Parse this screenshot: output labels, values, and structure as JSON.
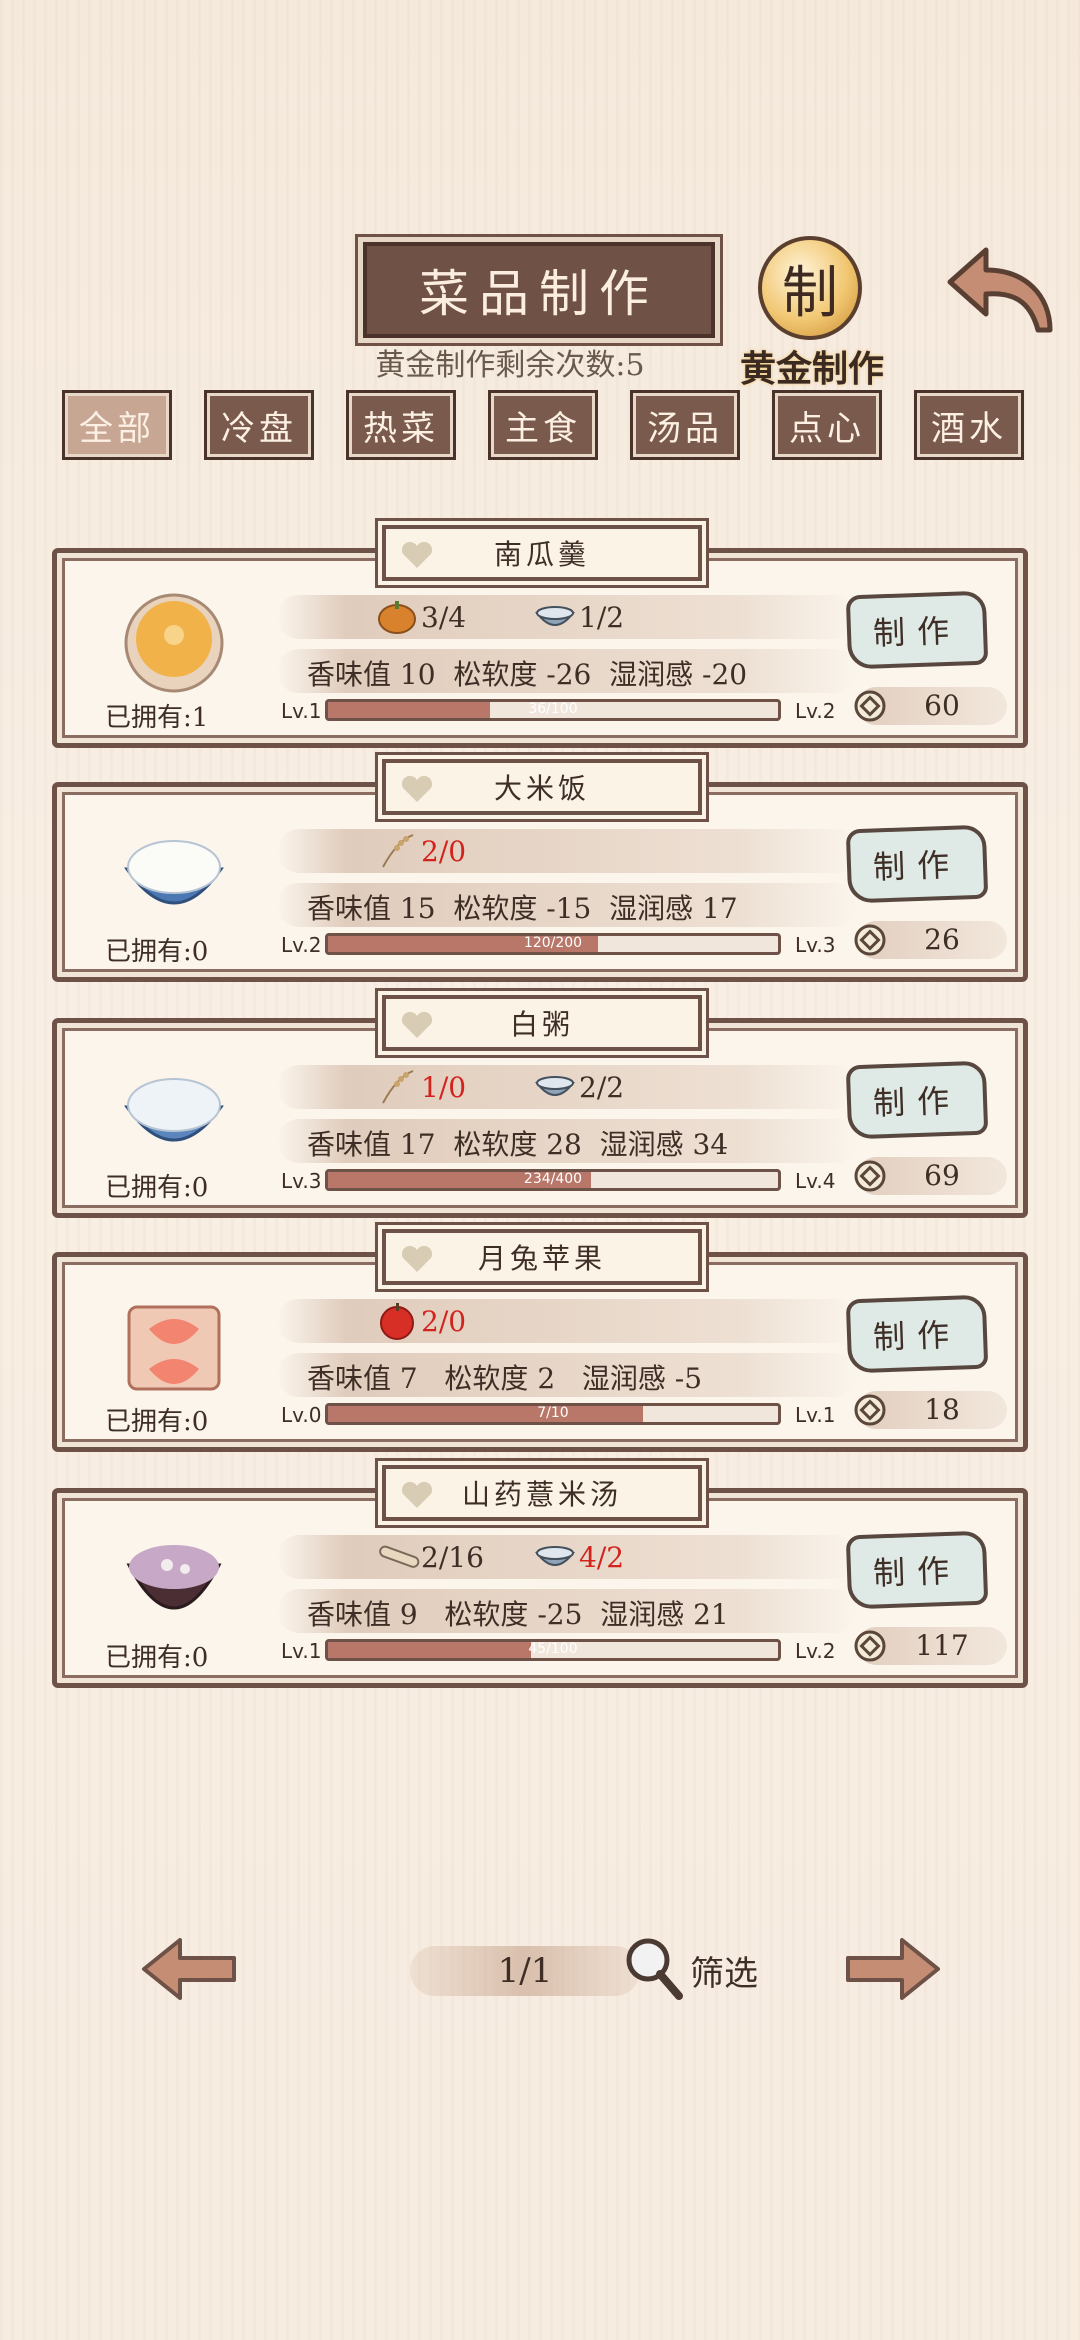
{
  "header": {
    "title": "菜品制作",
    "gold_remaining": "黄金制作剩余次数:5",
    "gold_seal_char": "制",
    "gold_button_label": "黄金制作"
  },
  "tabs": [
    {
      "label": "全部",
      "active": true
    },
    {
      "label": "冷盘",
      "active": false
    },
    {
      "label": "热菜",
      "active": false
    },
    {
      "label": "主食",
      "active": false
    },
    {
      "label": "汤品",
      "active": false
    },
    {
      "label": "点心",
      "active": false
    },
    {
      "label": "酒水",
      "active": false
    }
  ],
  "make_label": "制作",
  "recipes": [
    {
      "name": "南瓜羹",
      "owned": "已拥有:1",
      "ingredients": [
        {
          "icon": "pumpkin-icon",
          "count": "3/4",
          "short": false
        },
        {
          "icon": "bowl-icon",
          "count": "1/2",
          "short": false
        }
      ],
      "stats": "香味值 10  松软度 -26  湿润感 -20",
      "level": "Lv.1",
      "next_level": "Lv.2",
      "progress": "36/100",
      "progress_fraction": 0.36,
      "cost": "60"
    },
    {
      "name": "大米饭",
      "owned": "已拥有:0",
      "ingredients": [
        {
          "icon": "rice-stalk-icon",
          "count": "2/0",
          "short": true
        }
      ],
      "stats": "香味值 15  松软度 -15  湿润感 17",
      "level": "Lv.2",
      "next_level": "Lv.3",
      "progress": "120/200",
      "progress_fraction": 0.6,
      "cost": "26"
    },
    {
      "name": "白粥",
      "owned": "已拥有:0",
      "ingredients": [
        {
          "icon": "rice-stalk-icon",
          "count": "1/0",
          "short": true
        },
        {
          "icon": "bowl-icon",
          "count": "2/2",
          "short": false
        }
      ],
      "stats": "香味值 17  松软度 28  湿润感 34",
      "level": "Lv.3",
      "next_level": "Lv.4",
      "progress": "234/400",
      "progress_fraction": 0.585,
      "cost": "69"
    },
    {
      "name": "月兔苹果",
      "owned": "已拥有:0",
      "ingredients": [
        {
          "icon": "apple-icon",
          "count": "2/0",
          "short": true
        }
      ],
      "stats": "香味值 7   松软度 2   湿润感 -5",
      "level": "Lv.0",
      "next_level": "Lv.1",
      "progress": "7/10",
      "progress_fraction": 0.7,
      "cost": "18"
    },
    {
      "name": "山药薏米汤",
      "owned": "已拥有:0",
      "ingredients": [
        {
          "icon": "yam-icon",
          "count": "2/16",
          "short": false
        },
        {
          "icon": "bowl-icon",
          "count": "4/2",
          "short": true
        }
      ],
      "stats": "香味值 9   松软度 -25  湿润感 21",
      "level": "Lv.1",
      "next_level": "Lv.2",
      "progress": "45/100",
      "progress_fraction": 0.45,
      "cost": "117"
    }
  ],
  "footer": {
    "page": "1/1",
    "filter_label": "筛选"
  }
}
